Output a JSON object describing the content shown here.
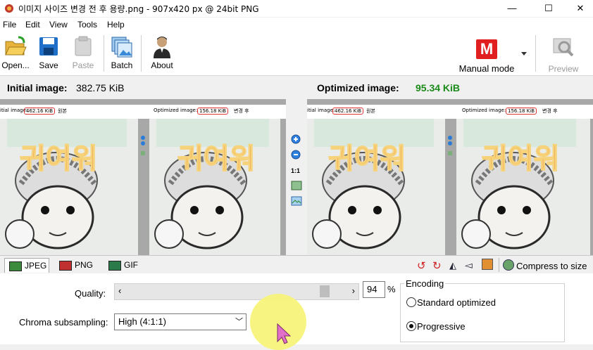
{
  "window": {
    "title": "이미지 사이즈 변경 전 후 용량.png - 907x420 px @ 24bit PNG",
    "minimize": "—",
    "maximize": "☐",
    "close": "✕"
  },
  "menu": [
    "File",
    "Edit",
    "View",
    "Tools",
    "Help"
  ],
  "toolbar": {
    "open": "Open...",
    "save": "Save",
    "paste": "Paste",
    "batch": "Batch",
    "about": "About",
    "mode_letter": "M",
    "mode": "Manual mode",
    "preview": "Preview"
  },
  "info": {
    "initial_label": "Initial image:",
    "initial_size": "382.75 KiB",
    "optimized_label": "Optimized image:",
    "optimized_size": "95.34 KiB"
  },
  "panes": {
    "left_a_label": "itial image:",
    "left_a_size": "462.16 KiB",
    "left_a_tag": "원본",
    "left_b_label": "Optimized image:",
    "left_b_size": "156.18 KiB",
    "left_b_tag": "변경 후",
    "right_a_label": "itial image:",
    "right_a_size": "462.16 KiB",
    "right_a_tag": "원본",
    "right_b_label": "Optimized image:",
    "right_b_size": "156.18 KiB",
    "right_b_tag": "변경 후",
    "art_text": "귀여워",
    "zoom_ratio": "1:1"
  },
  "tabs": {
    "jpeg": "JPEG",
    "png": "PNG",
    "gif": "GIF",
    "compress": "Compress to size"
  },
  "settings": {
    "quality_label": "Quality:",
    "quality_value": "94",
    "quality_unit": "%",
    "quality_level": 0.91,
    "chroma_label": "Chroma subsampling:",
    "chroma_value": "High (4:1:1)",
    "encoding_label": "Encoding",
    "encoding_standard": "Standard optimized",
    "encoding_progressive": "Progressive"
  },
  "colors": {
    "optimized_green": "#1a8a1a",
    "mode_red": "#e02020",
    "border_red": "#d33333"
  }
}
